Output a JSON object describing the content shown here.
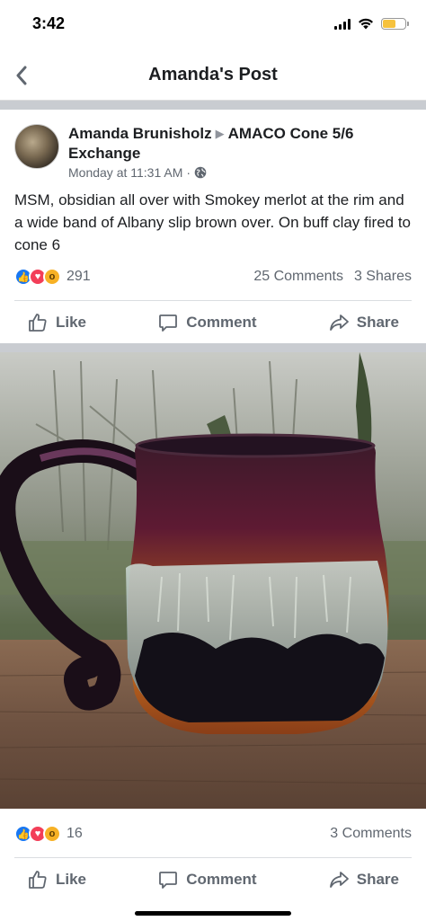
{
  "status_bar": {
    "time": "3:42"
  },
  "nav": {
    "title": "Amanda's Post"
  },
  "post": {
    "author": "Amanda Brunisholz",
    "group": "AMACO Cone 5/6 Exchange",
    "timestamp": "Monday at 11:31 AM",
    "separator": "·",
    "text": "MSM, obsidian all over with Smokey merlot at the rim and a wide band of Albany slip brown over.  On buff clay fired to cone 6",
    "reaction_count": "291",
    "comments": "25 Comments",
    "shares": "3 Shares",
    "actions": {
      "like": "Like",
      "comment": "Comment",
      "share": "Share"
    }
  },
  "photo_post": {
    "reaction_count": "16",
    "comments": "3 Comments",
    "actions": {
      "like": "Like",
      "comment": "Comment",
      "share": "Share"
    }
  },
  "icons": [
    "back-chevron-icon",
    "globe-icon",
    "like-icon",
    "comment-icon",
    "share-icon"
  ],
  "colors": {
    "like_blue": "#1877f2",
    "love_red": "#f33e58",
    "wow_yellow": "#f7b125",
    "gray_text": "#606770"
  }
}
